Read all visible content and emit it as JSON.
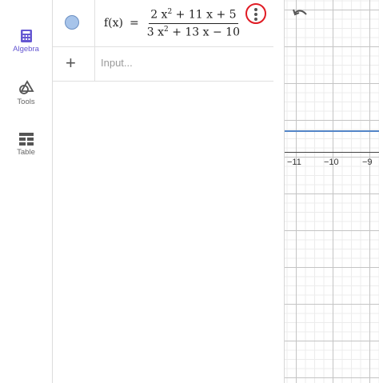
{
  "sidebar": {
    "items": [
      {
        "label": "Algebra",
        "icon": "calculator-icon",
        "active": true
      },
      {
        "label": "Tools",
        "icon": "shapes-icon",
        "active": false
      },
      {
        "label": "Table",
        "icon": "table-icon",
        "active": false
      }
    ]
  },
  "algebra": {
    "entry": {
      "lhs": "f(x)",
      "eq": "=",
      "num_pre": "2 x",
      "num_exp": "2",
      "num_post": " + 11 x + 5",
      "den_pre": "3 x",
      "den_exp": "2",
      "den_post": " + 13 x − 10",
      "color": "#a7c4ea"
    },
    "input": {
      "placeholder": "Input..."
    }
  },
  "graph": {
    "x_ticks": [
      "−11",
      "−10",
      "−9"
    ],
    "curve_color": "#5486c8"
  },
  "colors": {
    "accent": "#6557d2",
    "highlight": "#e01b24"
  }
}
